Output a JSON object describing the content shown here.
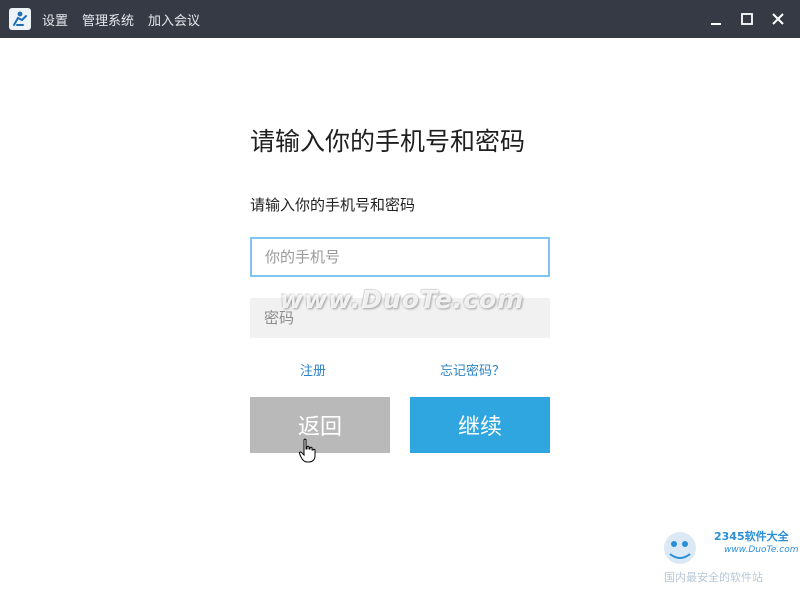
{
  "titlebar": {
    "menu": [
      "设置",
      "管理系统",
      "加入会议"
    ]
  },
  "main": {
    "title": "请输入你的手机号和密码",
    "label": "请输入你的手机号和密码",
    "phone_placeholder": "你的手机号",
    "password_placeholder": "密码",
    "register_link": "注册",
    "forgot_link": "忘记密码？",
    "back_button": "返回",
    "continue_button": "继续"
  },
  "overlay": {
    "watermark": "www.DuoTe.com",
    "corner_brand": "2345软件大全",
    "corner_url": "www.DuoTe.com",
    "corner_tagline": "国内最安全的软件站"
  },
  "colors": {
    "titlebar": "#353a44",
    "accent": "#2fa6df",
    "back_button": "#b9b9b9",
    "input_focus_border": "#7fc4ef",
    "link": "#2b84c6"
  }
}
